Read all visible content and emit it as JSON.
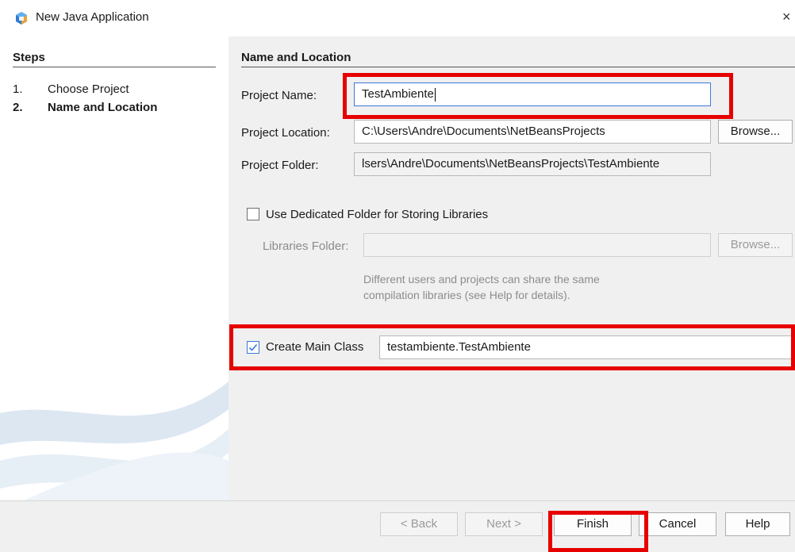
{
  "window": {
    "title": "New Java Application",
    "close_glyph": "×"
  },
  "steps": {
    "header": "Steps",
    "items": [
      {
        "num": "1.",
        "label": "Choose Project"
      },
      {
        "num": "2.",
        "label": "Name and Location"
      }
    ]
  },
  "form": {
    "section_title": "Name and Location",
    "project_name": {
      "label": "Project Name:",
      "value": "TestAmbiente"
    },
    "project_location": {
      "label": "Project Location:",
      "value": "C:\\Users\\Andre\\Documents\\NetBeansProjects",
      "browse_label": "Browse..."
    },
    "project_folder": {
      "label": "Project Folder:",
      "value": "lsers\\Andre\\Documents\\NetBeansProjects\\TestAmbiente"
    },
    "dedicated_folder": {
      "label": "Use Dedicated Folder for Storing Libraries",
      "checked": false
    },
    "libraries_folder": {
      "label": "Libraries Folder:",
      "value": "",
      "browse_label": "Browse..."
    },
    "hint_line1": "Different users and projects can share the same",
    "hint_line2": "compilation libraries (see Help for details).",
    "create_main_class": {
      "label": "Create Main Class",
      "checked": true,
      "value": "testambiente.TestAmbiente"
    }
  },
  "buttons": {
    "back": "< Back",
    "next": "Next >",
    "finish": "Finish",
    "cancel": "Cancel",
    "help": "Help"
  },
  "colors": {
    "highlight": "#e60000",
    "accent": "#3b78d8"
  },
  "icons": {
    "app": "netbeans-cube-icon",
    "check": "checkmark-icon"
  }
}
